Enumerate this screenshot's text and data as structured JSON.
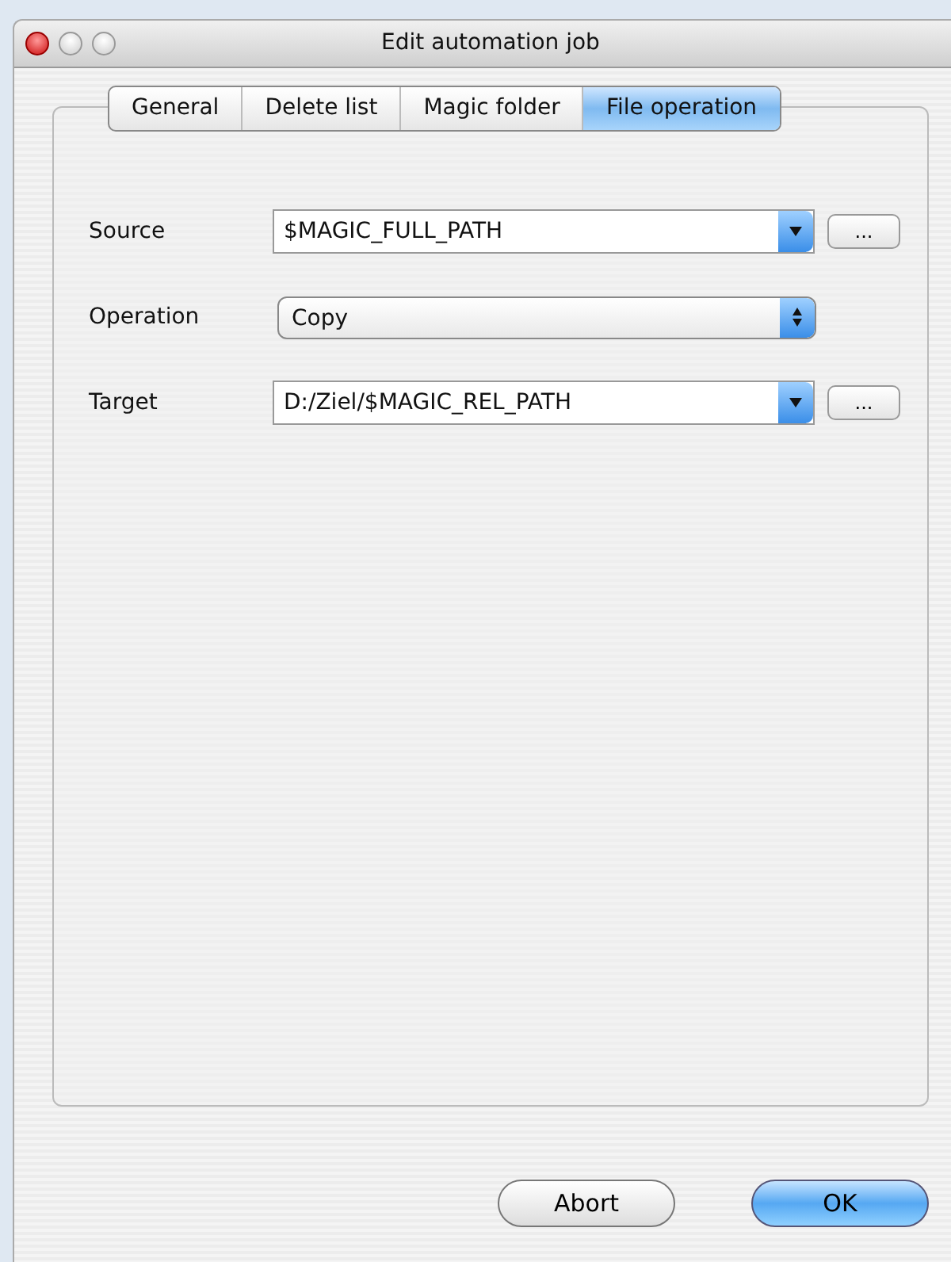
{
  "window": {
    "title": "Edit automation job"
  },
  "tabs": [
    {
      "label": "General",
      "selected": false
    },
    {
      "label": "Delete list",
      "selected": false
    },
    {
      "label": "Magic folder",
      "selected": false
    },
    {
      "label": "File operation",
      "selected": true
    }
  ],
  "fields": [
    {
      "label": "Source",
      "kind": "combo",
      "value": "$MAGIC_FULL_PATH",
      "browse": "..."
    },
    {
      "label": "Operation",
      "kind": "popup",
      "value": "Copy"
    },
    {
      "label": "Target",
      "kind": "combo",
      "value": "D:/Ziel/$MAGIC_REL_PATH",
      "browse": "..."
    }
  ],
  "buttons": [
    {
      "label": "Abort",
      "kind": "normal"
    },
    {
      "label": "OK",
      "kind": "default"
    }
  ]
}
